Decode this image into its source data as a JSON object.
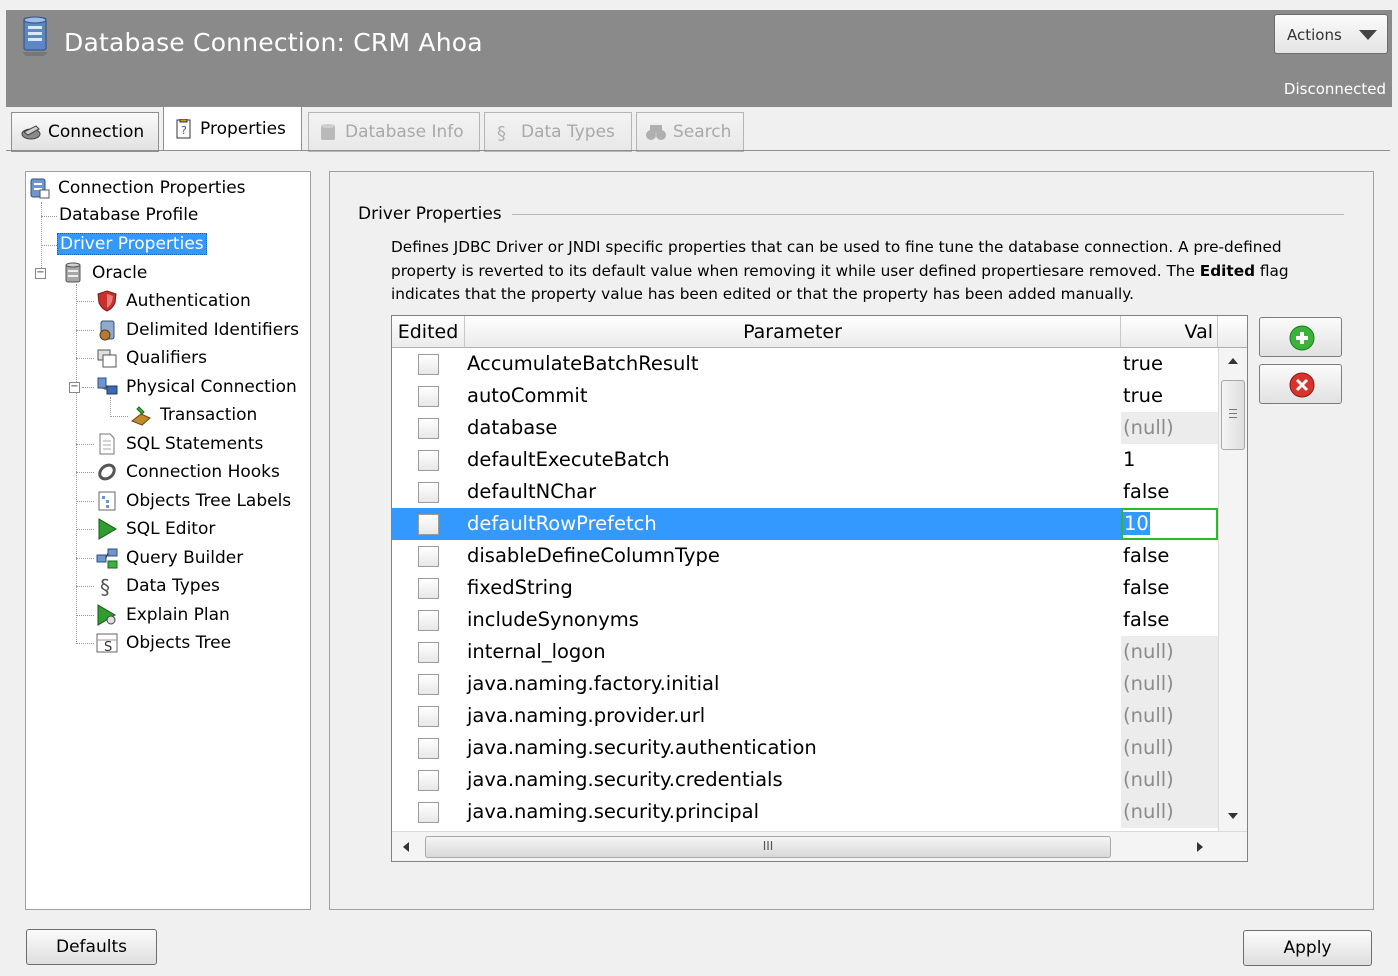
{
  "window": {
    "title": "Database Connection: CRM Ahoa",
    "actions_label": "Actions",
    "status": "Disconnected",
    "icon": "database-icon"
  },
  "tabs": [
    {
      "label": "Connection",
      "icon": "connection-icon",
      "state": "normal"
    },
    {
      "label": "Properties",
      "icon": "properties-icon",
      "state": "active"
    },
    {
      "label": "Database Info",
      "icon": "database-info-icon",
      "state": "disabled"
    },
    {
      "label": "Data Types",
      "icon": "data-types-icon",
      "state": "disabled"
    },
    {
      "label": "Search",
      "icon": "binoculars-icon",
      "state": "disabled"
    }
  ],
  "tree": {
    "root": "Connection Properties",
    "database_profile": "Database Profile",
    "driver_properties": "Driver Properties",
    "oracle": "Oracle",
    "authentication": "Authentication",
    "delimited_identifiers": "Delimited Identifiers",
    "qualifiers": "Qualifiers",
    "physical_connection": "Physical Connection",
    "transaction": "Transaction",
    "sql_statements": "SQL Statements",
    "connection_hooks": "Connection Hooks",
    "objects_tree_labels": "Objects Tree Labels",
    "sql_editor": "SQL Editor",
    "query_builder": "Query Builder",
    "data_types": "Data Types",
    "explain_plan": "Explain Plan",
    "objects_tree": "Objects Tree"
  },
  "section": {
    "title": "Driver Properties",
    "description_1": "Defines JDBC Driver or JNDI specific properties that can be used to fine tune the database connection. A pre-defined",
    "description_2a": "property is reverted to its default value when removing it while user defined propertiesare removed. The ",
    "description_2b": "Edited",
    "description_2c": " flag",
    "description_3": "indicates that the property value has been edited or that the property has been added manually."
  },
  "table": {
    "columns": [
      "Edited",
      "Parameter",
      "Val"
    ],
    "rows": [
      {
        "edited": false,
        "parameter": "AccumulateBatchResult",
        "value": "true",
        "null": false
      },
      {
        "edited": false,
        "parameter": "autoCommit",
        "value": "true",
        "null": false
      },
      {
        "edited": false,
        "parameter": "database",
        "value": "(null)",
        "null": true
      },
      {
        "edited": false,
        "parameter": "defaultExecuteBatch",
        "value": "1",
        "null": false
      },
      {
        "edited": false,
        "parameter": "defaultNChar",
        "value": "false",
        "null": false
      },
      {
        "edited": false,
        "parameter": "defaultRowPrefetch",
        "value": "10",
        "null": false,
        "selected": true
      },
      {
        "edited": false,
        "parameter": "disableDefineColumnType",
        "value": "false",
        "null": false
      },
      {
        "edited": false,
        "parameter": "fixedString",
        "value": "false",
        "null": false
      },
      {
        "edited": false,
        "parameter": "includeSynonyms",
        "value": "false",
        "null": false
      },
      {
        "edited": false,
        "parameter": "internal_logon",
        "value": "(null)",
        "null": true
      },
      {
        "edited": false,
        "parameter": "java.naming.factory.initial",
        "value": "(null)",
        "null": true
      },
      {
        "edited": false,
        "parameter": "java.naming.provider.url",
        "value": "(null)",
        "null": true
      },
      {
        "edited": false,
        "parameter": "java.naming.security.authentication",
        "value": "(null)",
        "null": true
      },
      {
        "edited": false,
        "parameter": "java.naming.security.credentials",
        "value": "(null)",
        "null": true
      },
      {
        "edited": false,
        "parameter": "java.naming.security.principal",
        "value": "(null)",
        "null": true
      }
    ],
    "hscroll_grip": "III"
  },
  "buttons": {
    "add_icon": "add-icon",
    "remove_icon": "remove-icon",
    "defaults": "Defaults",
    "apply": "Apply"
  },
  "colors": {
    "header": "#8a8a8a",
    "selection": "#3399ff",
    "add": "#3bb33b",
    "remove": "#d9342b"
  }
}
